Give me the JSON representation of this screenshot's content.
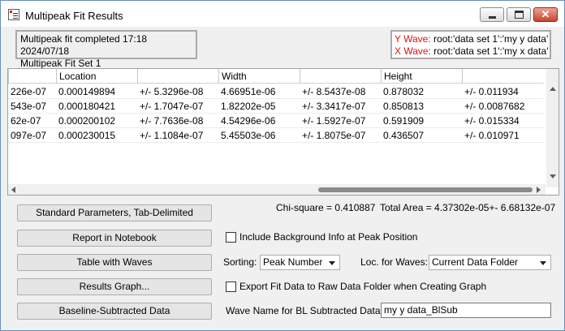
{
  "window": {
    "title": "Multipeak Fit Results",
    "close_label": "✕"
  },
  "status": {
    "line1": "Multipeak fit completed 17:18 2024/07/18",
    "line2": "Multipeak Fit Set 1"
  },
  "waves": {
    "y_label": "Y Wave:",
    "y_value": "root:'data set 1':'my y data'",
    "x_label": "X Wave:",
    "x_value": "root:'data set 1':'my x data'",
    "label_color": "#e01010"
  },
  "table": {
    "headers": [
      "",
      "Location",
      "",
      "Width",
      "",
      "Height",
      ""
    ],
    "rows": [
      [
        "226e-07",
        "0.000149894",
        "+/- 5.3296e-08",
        "4.66951e-06",
        "+/- 8.5437e-08",
        "0.878032",
        "+/- 0.011934"
      ],
      [
        "543e-07",
        "0.000180421",
        "+/- 1.7047e-07",
        "1.82202e-05",
        "+/- 3.3417e-07",
        "0.850813",
        "+/- 0.0087682"
      ],
      [
        "62e-07",
        "0.000200102",
        "+/- 7.7636e-08",
        "4.54296e-06",
        "+/- 1.5927e-07",
        "0.591909",
        "+/- 0.015334"
      ],
      [
        "097e-07",
        "0.000230015",
        "+/- 1.1084e-07",
        "5.45503e-06",
        "+/- 1.8075e-07",
        "0.436507",
        "+/- 0.010971"
      ]
    ]
  },
  "stats": {
    "chi_square": "Chi-square = 0.410887",
    "total_area": "Total Area = 4.37302e-05+- 6.68132e-07"
  },
  "buttons": {
    "standard_params": "Standard Parameters, Tab-Delimited",
    "report_notebook": "Report in Notebook",
    "table_waves": "Table with Waves",
    "results_graph": "Results Graph...",
    "baseline_subtracted": "Baseline-Subtracted Data"
  },
  "options": {
    "include_background_label": "Include Background Info at Peak Position",
    "include_background_checked": false,
    "sorting_label": "Sorting:",
    "sorting_value": "Peak Number",
    "loc_waves_label": "Loc. for Waves:",
    "loc_waves_value": "Current Data Folder",
    "export_fit_label": "Export Fit Data to Raw Data Folder when Creating Graph",
    "export_fit_checked": false,
    "wave_name_label": "Wave Name for BL Subtracted Data:",
    "wave_name_value": "my y data_BlSub"
  }
}
